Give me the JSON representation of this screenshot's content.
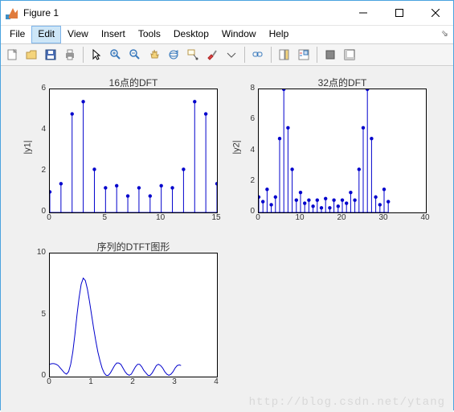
{
  "window": {
    "title": "Figure 1",
    "minimize_tip": "Minimize",
    "maximize_tip": "Maximize",
    "close_tip": "Close"
  },
  "menubar": {
    "items": [
      "File",
      "Edit",
      "View",
      "Insert",
      "Tools",
      "Desktop",
      "Window",
      "Help"
    ],
    "active_index": 1
  },
  "toolbar": {
    "icons": [
      "new",
      "open",
      "save",
      "print",
      "sep",
      "pointer",
      "zoom-in",
      "zoom-out",
      "pan",
      "rotate3d",
      "data-cursor",
      "brush",
      "dropdown",
      "sep",
      "link",
      "sep",
      "insert-colorbar",
      "insert-legend",
      "sep",
      "hide-plot-tools",
      "show-plot-tools"
    ]
  },
  "watermark": "http://blog.csdn.net/ytang",
  "chart_data": [
    {
      "type": "stem",
      "title": "16点的DFT",
      "xlabel": "",
      "ylabel": "|y1|",
      "xlim": [
        0,
        15
      ],
      "ylim": [
        0,
        6
      ],
      "xticks": [
        0,
        5,
        10,
        15
      ],
      "yticks": [
        0,
        2,
        4,
        6
      ],
      "categories": [
        0,
        1,
        2,
        3,
        4,
        5,
        6,
        7,
        8,
        9,
        10,
        11,
        12,
        13,
        14,
        15
      ],
      "values": [
        1.0,
        1.4,
        4.8,
        5.4,
        2.1,
        1.2,
        1.3,
        0.8,
        1.2,
        0.8,
        1.3,
        1.2,
        2.1,
        5.4,
        4.8,
        1.4
      ]
    },
    {
      "type": "stem",
      "title": "32点的DFT",
      "xlabel": "",
      "ylabel": "|y2|",
      "xlim": [
        0,
        40
      ],
      "ylim": [
        0,
        8
      ],
      "xticks": [
        0,
        10,
        20,
        30,
        40
      ],
      "yticks": [
        0,
        2,
        4,
        6,
        8
      ],
      "categories": [
        0,
        1,
        2,
        3,
        4,
        5,
        6,
        7,
        8,
        9,
        10,
        11,
        12,
        13,
        14,
        15,
        16,
        17,
        18,
        19,
        20,
        21,
        22,
        23,
        24,
        25,
        26,
        27,
        28,
        29,
        30,
        31
      ],
      "values": [
        1.0,
        0.7,
        1.5,
        0.5,
        1.0,
        4.8,
        8.0,
        5.5,
        2.8,
        0.8,
        1.3,
        0.6,
        0.8,
        0.4,
        0.8,
        0.3,
        0.9,
        0.3,
        0.8,
        0.4,
        0.8,
        0.6,
        1.3,
        0.8,
        2.8,
        5.5,
        8.0,
        4.8,
        1.0,
        0.5,
        1.5,
        0.7
      ]
    },
    {
      "type": "line",
      "title": "序列的DTFT图形",
      "xlabel": "",
      "ylabel": "",
      "xlim": [
        0,
        4
      ],
      "ylim": [
        0,
        10
      ],
      "xticks": [
        0,
        1,
        2,
        3,
        4
      ],
      "yticks": [
        0,
        5,
        10
      ],
      "x": [
        0,
        0.05,
        0.1,
        0.15,
        0.2,
        0.25,
        0.3,
        0.35,
        0.4,
        0.45,
        0.5,
        0.55,
        0.6,
        0.65,
        0.7,
        0.75,
        0.8,
        0.85,
        0.9,
        0.95,
        1.0,
        1.05,
        1.1,
        1.15,
        1.2,
        1.25,
        1.3,
        1.35,
        1.4,
        1.45,
        1.5,
        1.55,
        1.6,
        1.65,
        1.7,
        1.75,
        1.8,
        1.85,
        1.9,
        1.95,
        2.0,
        2.05,
        2.1,
        2.15,
        2.2,
        2.25,
        2.3,
        2.35,
        2.4,
        2.45,
        2.5,
        2.55,
        2.6,
        2.65,
        2.7,
        2.75,
        2.8,
        2.85,
        2.9,
        2.95,
        3.0,
        3.05,
        3.1,
        3.14
      ],
      "y": [
        1.0,
        1.05,
        1.05,
        1.0,
        0.9,
        0.7,
        0.5,
        0.3,
        0.2,
        0.4,
        1.0,
        2.0,
        3.4,
        5.0,
        6.4,
        7.5,
        8.0,
        7.8,
        7.1,
        6.1,
        5.0,
        3.9,
        2.9,
        2.0,
        1.3,
        0.7,
        0.3,
        0.1,
        0.1,
        0.3,
        0.6,
        0.9,
        1.1,
        1.1,
        1.0,
        0.7,
        0.4,
        0.2,
        0.1,
        0.2,
        0.5,
        0.8,
        1.0,
        1.0,
        0.8,
        0.5,
        0.3,
        0.1,
        0.1,
        0.3,
        0.6,
        0.9,
        1.0,
        0.9,
        0.7,
        0.4,
        0.2,
        0.1,
        0.2,
        0.4,
        0.7,
        0.9,
        0.95,
        0.9
      ]
    }
  ]
}
